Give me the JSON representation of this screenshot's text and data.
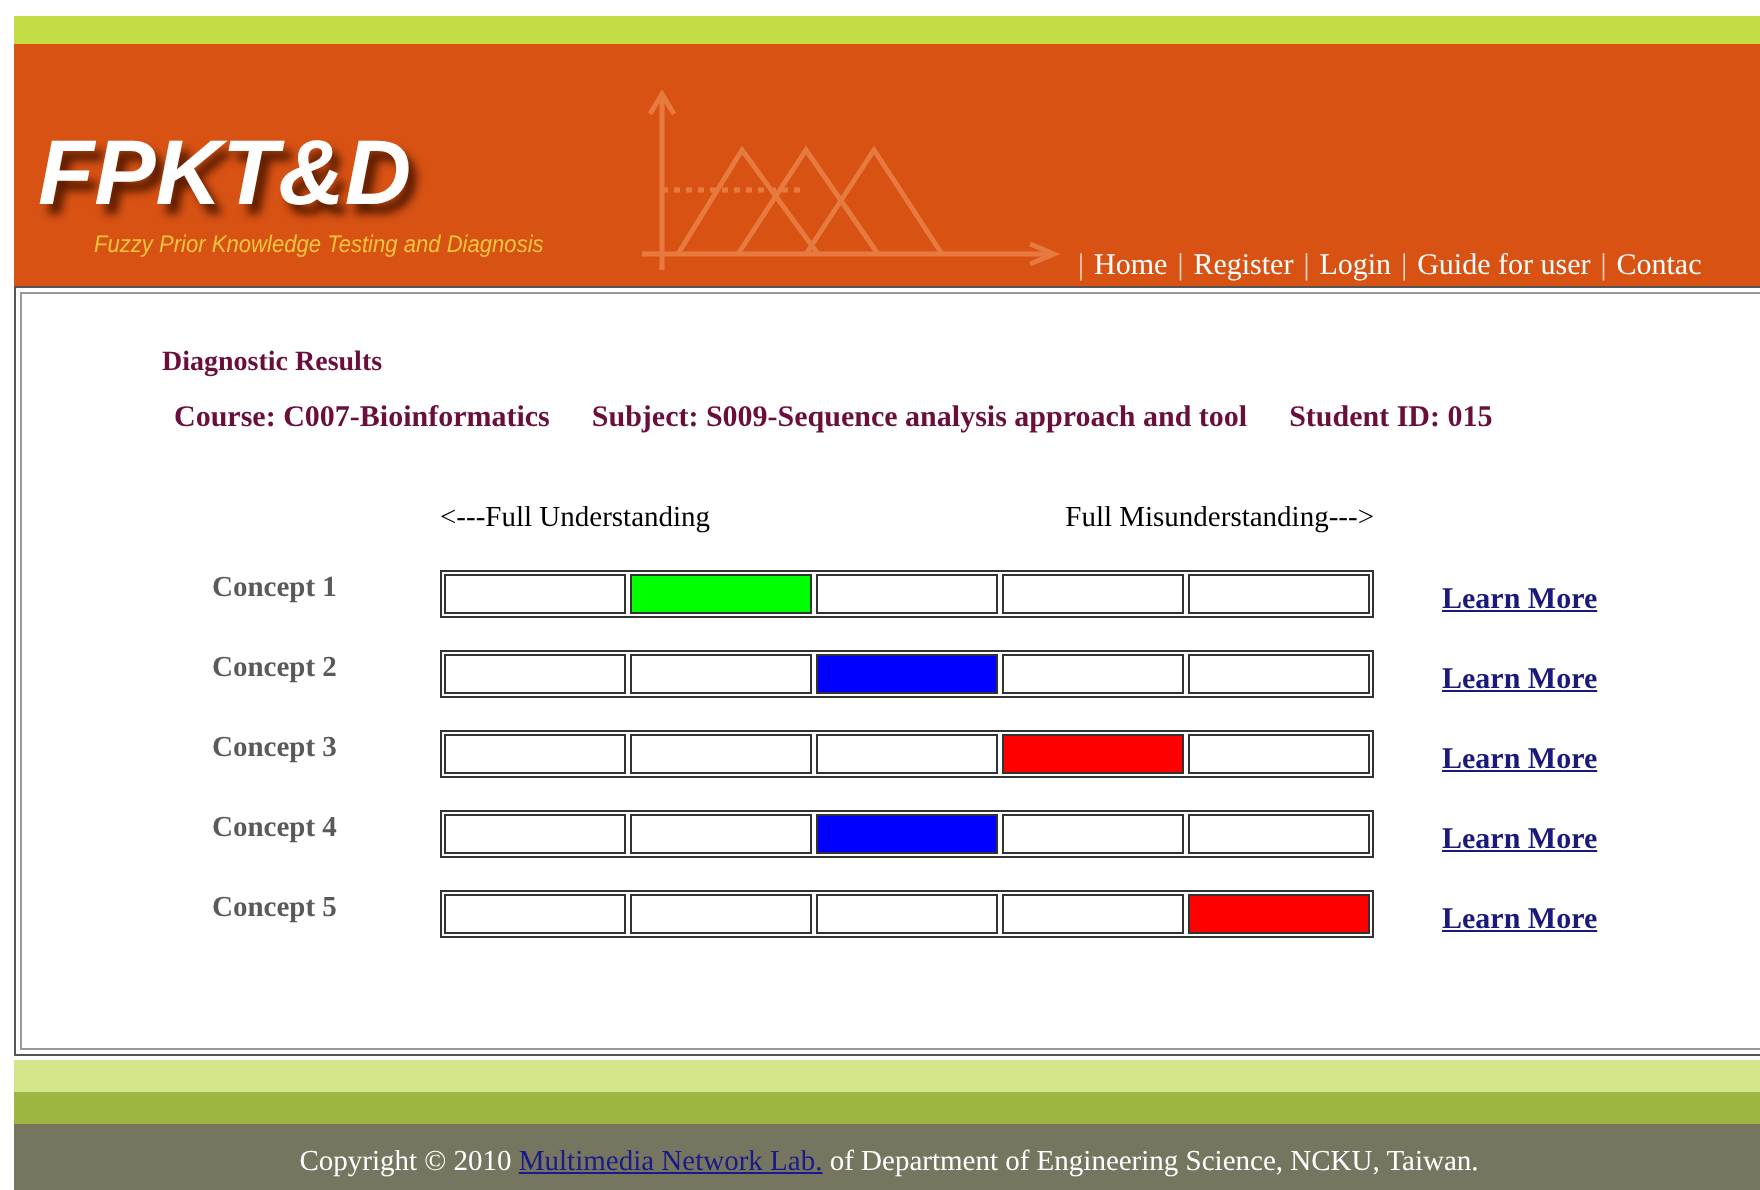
{
  "header": {
    "logo": "FPKT&D",
    "tagline": "Fuzzy Prior Knowledge Testing and Diagnosis",
    "nav": [
      {
        "kind": "separator",
        "label": "|"
      },
      {
        "kind": "link",
        "label": "Home"
      },
      {
        "kind": "separator",
        "label": "|"
      },
      {
        "kind": "link",
        "label": "Register"
      },
      {
        "kind": "separator",
        "label": "|"
      },
      {
        "kind": "link",
        "label": "Login"
      },
      {
        "kind": "separator",
        "label": "|"
      },
      {
        "kind": "link",
        "label": "Guide for user"
      },
      {
        "kind": "separator",
        "label": "|"
      },
      {
        "kind": "link",
        "label": "Contac"
      }
    ]
  },
  "results": {
    "title": "Diagnostic Results",
    "course": "Course: C007-Bioinformatics",
    "subject": "Subject: S009-Sequence analysis approach and tool",
    "student": "Student ID: 015",
    "scale_left": "<---Full Understanding",
    "scale_right": "Full Misunderstanding--->",
    "concepts": [
      {
        "label": "Concept 1",
        "link": "Learn More",
        "cells": [
          {
            "filled": false
          },
          {
            "filled": true,
            "color": "#00ff00"
          },
          {
            "filled": false
          },
          {
            "filled": false
          },
          {
            "filled": false
          }
        ]
      },
      {
        "label": "Concept 2",
        "link": "Learn More",
        "cells": [
          {
            "filled": false
          },
          {
            "filled": false
          },
          {
            "filled": true,
            "color": "#0000ff"
          },
          {
            "filled": false
          },
          {
            "filled": false
          }
        ]
      },
      {
        "label": "Concept 3",
        "link": "Learn More",
        "cells": [
          {
            "filled": false
          },
          {
            "filled": false
          },
          {
            "filled": false
          },
          {
            "filled": true,
            "color": "#ff0000"
          },
          {
            "filled": false
          }
        ]
      },
      {
        "label": "Concept 4",
        "link": "Learn More",
        "cells": [
          {
            "filled": false
          },
          {
            "filled": false
          },
          {
            "filled": true,
            "color": "#0000ff"
          },
          {
            "filled": false
          },
          {
            "filled": false
          }
        ]
      },
      {
        "label": "Concept 5",
        "link": "Learn More",
        "cells": [
          {
            "filled": false
          },
          {
            "filled": false
          },
          {
            "filled": false
          },
          {
            "filled": false
          },
          {
            "filled": true,
            "color": "#ff0000"
          }
        ]
      }
    ]
  },
  "footer": {
    "before": "Copyright © 2010",
    "link": "Multimedia Network Lab.",
    "after": "of Department of Engineering Science, NCKU, Taiwan."
  }
}
